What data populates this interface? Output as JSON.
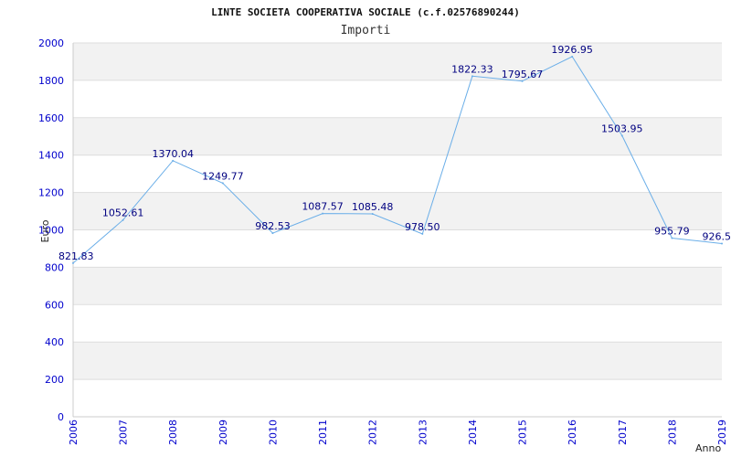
{
  "chart_data": {
    "type": "line",
    "title": "LINTE SOCIETA COOPERATIVA SOCIALE (c.f.02576890244)",
    "subtitle": "Importi",
    "xlabel": "Anno",
    "ylabel": "Euro",
    "ylim": [
      0,
      2000
    ],
    "yticks": [
      0,
      200,
      400,
      600,
      800,
      1000,
      1200,
      1400,
      1600,
      1800,
      2000
    ],
    "grid": true,
    "categories": [
      "2006",
      "2007",
      "2008",
      "2009",
      "2010",
      "2011",
      "2012",
      "2013",
      "2014",
      "2015",
      "2016",
      "2017",
      "2018",
      "2019"
    ],
    "series": [
      {
        "values": [
          821.83,
          1052.61,
          1370.04,
          1249.77,
          982.53,
          1087.57,
          1085.48,
          978.5,
          1822.33,
          1795.67,
          1926.95,
          1503.95,
          955.79,
          926.5
        ],
        "labels": [
          "821.83",
          "1052.61",
          "1370.04",
          "1249.77",
          "982.53",
          "1087.57",
          "1085.48",
          "978.50",
          "1822.33",
          "1795.67",
          "1926.95",
          "1503.95",
          "955.79",
          "926.5"
        ]
      }
    ],
    "colors": {
      "line": "#6aaee8",
      "tick_text": "#0000cc",
      "data_label": "#000080",
      "band": "#f2f2f2",
      "grid": "#dddddd",
      "axis": "#cccccc"
    }
  }
}
